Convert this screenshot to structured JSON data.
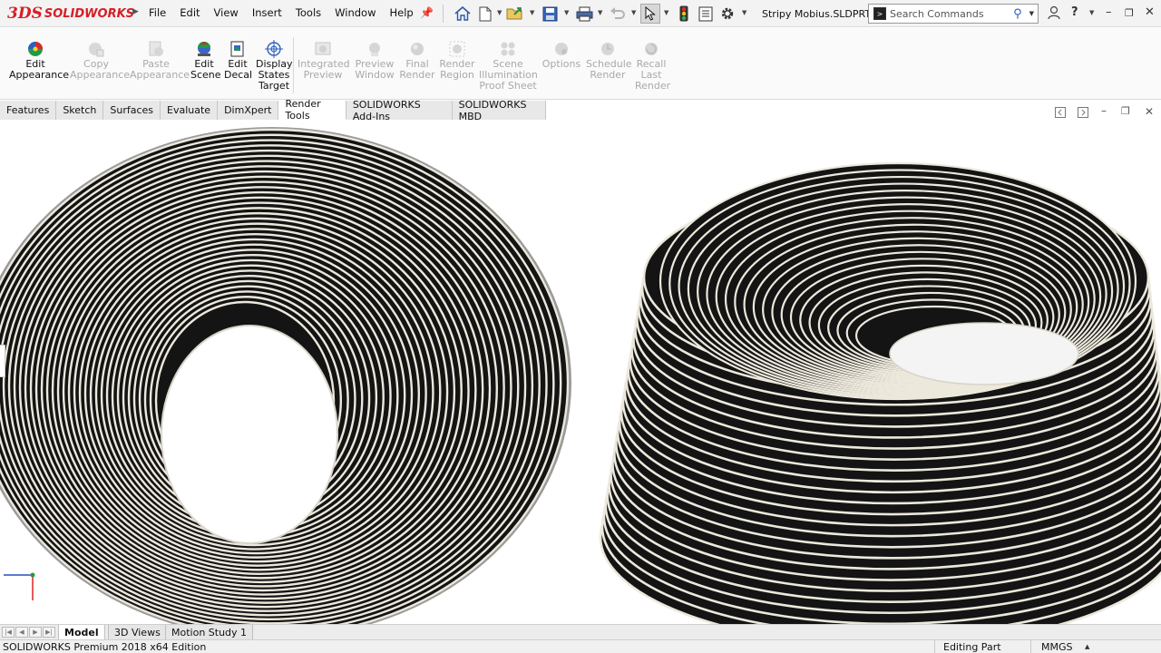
{
  "app": {
    "logo_mark": "3DS",
    "logo_text": "SOLIDWORKS",
    "document_title": "Stripy Mobius.SLDPRT"
  },
  "menu": [
    "File",
    "Edit",
    "View",
    "Insert",
    "Tools",
    "Window",
    "Help"
  ],
  "search": {
    "placeholder": "Search Commands"
  },
  "ribbon": [
    {
      "label_lines": [
        "Edit",
        "Appearance"
      ],
      "enabled": true,
      "icon": "appearance-icon"
    },
    {
      "label_lines": [
        "Copy",
        "Appearance"
      ],
      "enabled": false,
      "icon": "copy-appearance-icon"
    },
    {
      "label_lines": [
        "Paste",
        "Appearance"
      ],
      "enabled": false,
      "icon": "paste-appearance-icon"
    },
    {
      "label_lines": [
        "Edit",
        "Scene"
      ],
      "enabled": true,
      "icon": "scene-icon"
    },
    {
      "label_lines": [
        "Edit",
        "Decal"
      ],
      "enabled": true,
      "icon": "decal-icon"
    },
    {
      "label_lines": [
        "Display",
        "States",
        "Target"
      ],
      "enabled": true,
      "icon": "target-icon"
    },
    {
      "label_lines": [
        "Integrated",
        "Preview"
      ],
      "enabled": false,
      "icon": "integrated-preview-icon"
    },
    {
      "label_lines": [
        "Preview",
        "Window"
      ],
      "enabled": false,
      "icon": "preview-window-icon"
    },
    {
      "label_lines": [
        "Final",
        "Render"
      ],
      "enabled": false,
      "icon": "final-render-icon"
    },
    {
      "label_lines": [
        "Render",
        "Region"
      ],
      "enabled": false,
      "icon": "render-region-icon"
    },
    {
      "label_lines": [
        "Scene",
        "Illumination",
        "Proof Sheet"
      ],
      "enabled": false,
      "icon": "illumination-icon"
    },
    {
      "label_lines": [
        "Options"
      ],
      "enabled": false,
      "icon": "options-icon"
    },
    {
      "label_lines": [
        "Schedule",
        "Render"
      ],
      "enabled": false,
      "icon": "schedule-render-icon"
    },
    {
      "label_lines": [
        "Recall",
        "Last",
        "Render"
      ],
      "enabled": false,
      "icon": "recall-render-icon"
    }
  ],
  "tabs": [
    "Features",
    "Sketch",
    "Surfaces",
    "Evaluate",
    "DimXpert",
    "Render Tools",
    "SOLIDWORKS Add-Ins",
    "SOLIDWORKS MBD"
  ],
  "active_tab": "Render Tools",
  "bottom_tabs": [
    "Model",
    "3D Views",
    "Motion Study 1"
  ],
  "active_bottom_tab": "Model",
  "status": {
    "edition": "SOLIDWORKS Premium 2018 x64 Edition",
    "mode": "Editing Part",
    "units": "MMGS"
  },
  "colors": {
    "brand": "#d61f26",
    "stripe_dark": "#141414",
    "stripe_light": "#ece8dc",
    "viewport_bg": "#ffffff"
  }
}
